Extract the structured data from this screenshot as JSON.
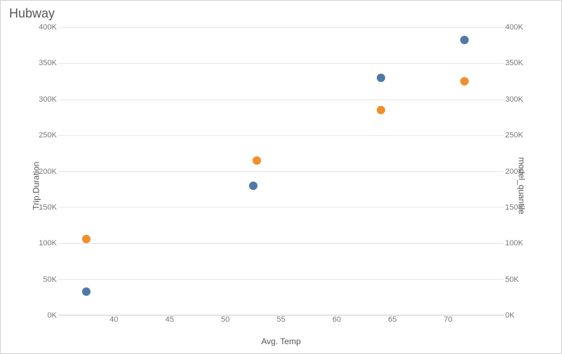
{
  "chart_data": {
    "type": "scatter",
    "title": "Hubway",
    "xlabel": "Avg. Temp",
    "ylabel_left": "Trip.Duration",
    "ylabel_right": "model_quantile",
    "xlim": [
      35,
      75
    ],
    "ylim": [
      0,
      400000
    ],
    "x_ticks": [
      40,
      45,
      50,
      55,
      60,
      65,
      70
    ],
    "y_ticks": [
      {
        "v": 0,
        "label": "0K"
      },
      {
        "v": 50000,
        "label": "50K"
      },
      {
        "v": 100000,
        "label": "100K"
      },
      {
        "v": 150000,
        "label": "150K"
      },
      {
        "v": 200000,
        "label": "200K"
      },
      {
        "v": 250000,
        "label": "250K"
      },
      {
        "v": 300000,
        "label": "300K"
      },
      {
        "v": 350000,
        "label": "350K"
      },
      {
        "v": 400000,
        "label": "400K"
      }
    ],
    "series": [
      {
        "name": "Trip.Duration",
        "color": "blue",
        "points": [
          {
            "x": 37.5,
            "y": 32000
          },
          {
            "x": 52.5,
            "y": 180000
          },
          {
            "x": 64.0,
            "y": 330000
          },
          {
            "x": 71.5,
            "y": 382000
          }
        ]
      },
      {
        "name": "model_quantile",
        "color": "orange",
        "points": [
          {
            "x": 37.5,
            "y": 105000
          },
          {
            "x": 52.8,
            "y": 215000
          },
          {
            "x": 64.0,
            "y": 285000
          },
          {
            "x": 71.5,
            "y": 325000
          }
        ]
      }
    ]
  }
}
